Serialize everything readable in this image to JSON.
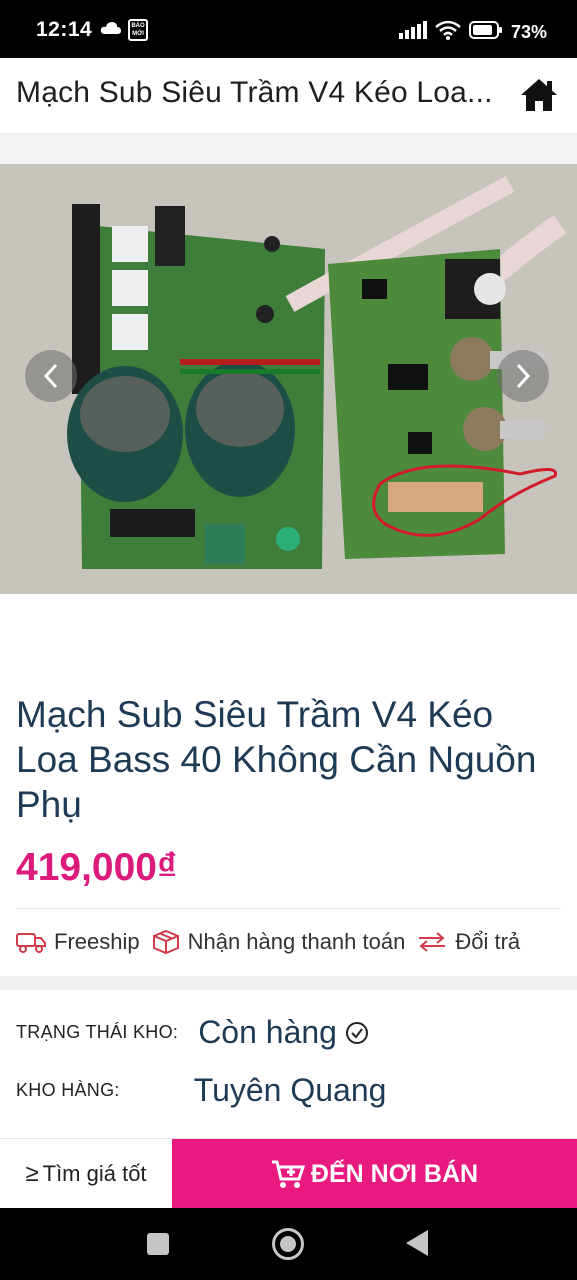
{
  "status_bar": {
    "time": "12:14",
    "news_badge": "BÁO MỚI",
    "battery": "73%"
  },
  "header": {
    "title": "Mạch Sub Siêu Trầm V4 Kéo Loa..."
  },
  "product": {
    "title": "Mạch Sub Siêu Trầm V4 Kéo Loa Bass 40 Không Cần Nguồn Phụ",
    "price": "419,000₫",
    "features": [
      {
        "icon": "truck-icon",
        "label": "Freeship"
      },
      {
        "icon": "box-icon",
        "label": "Nhận hàng thanh toán"
      },
      {
        "icon": "exchange-icon",
        "label": "Đổi trả"
      }
    ],
    "stock_label": "TRẠNG THÁI KHO:",
    "stock_value": "Còn hàng",
    "warehouse_label": "KHO HÀNG:",
    "warehouse_value": "Tuyên Quang"
  },
  "bottom_bar": {
    "best_price_symbol": "≥",
    "best_price_label": "Tìm giá tốt",
    "to_seller_label": "ĐẾN NƠI BÁN"
  },
  "colors": {
    "accent": "#e8197f",
    "price": "#dc1a7b",
    "title": "#1e3a55",
    "feature_icon": "#d23b4a"
  }
}
